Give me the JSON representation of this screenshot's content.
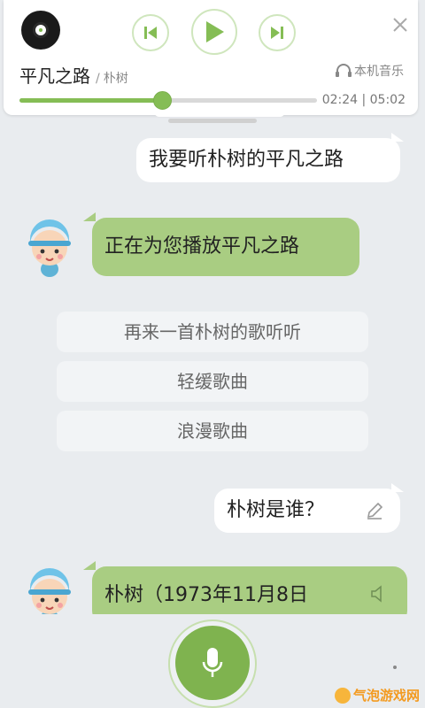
{
  "player": {
    "title": "平凡之路",
    "separator": "/",
    "artist": "朴树",
    "source": "本机音乐",
    "time": "02:24 | 05:02",
    "progress": 0.48
  },
  "chat": {
    "user_1": "我要听朴树的平凡之路",
    "bot_1": "正在为您播放平凡之路",
    "suggestions": [
      "再来一首朴树的歌听听",
      "轻缓歌曲",
      "浪漫歌曲"
    ],
    "user_2": "朴树是谁？",
    "bot_2": "朴树（1973年11月8日"
  },
  "watermark": "气泡游戏网",
  "colors": {
    "accent": "#85bd55",
    "bot_bubble": "#a9cd82",
    "background": "#e9ecef"
  },
  "icons": [
    "vinyl-icon",
    "previous-icon",
    "play-icon",
    "next-icon",
    "close-icon",
    "headphones-icon",
    "edit-icon",
    "speaker-icon",
    "microphone-icon"
  ]
}
